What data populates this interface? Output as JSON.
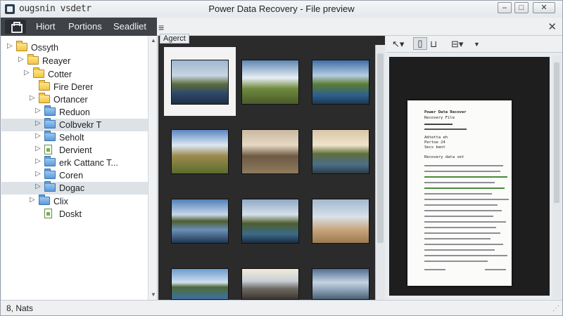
{
  "window": {
    "left_title": "ougsnin vsdetr",
    "title": "Power Data Recovery - File preview",
    "minimize_label": "–",
    "maximize_label": "□",
    "close_label": "✕"
  },
  "menu": {
    "items": [
      "Hiort",
      "Portions",
      "Seadliet"
    ],
    "hamburger": "≡",
    "close": "✕"
  },
  "tree": {
    "items": [
      {
        "label": "Ossyth",
        "icon": "folder-icon",
        "color": "yellow"
      },
      {
        "label": "Reayer",
        "icon": "folder-icon",
        "color": "yellow"
      },
      {
        "label": "Cotter",
        "icon": "folder-icon",
        "color": "yellow"
      },
      {
        "label": "Fire Derer",
        "icon": "folder-icon",
        "color": "yellow"
      },
      {
        "label": "Ortancer",
        "icon": "folder-icon",
        "color": "yellow"
      },
      {
        "label": "Reduon",
        "icon": "folder-icon",
        "color": "blue"
      },
      {
        "label": "Colbvekr T",
        "icon": "folder-icon",
        "color": "blue"
      },
      {
        "label": "Seholt",
        "icon": "folder-icon",
        "color": "blue"
      },
      {
        "label": "Dervient",
        "icon": "file-icon",
        "color": "green"
      },
      {
        "label": "erk Cattanc T...",
        "icon": "folder-icon",
        "color": "blue"
      },
      {
        "label": "Coren",
        "icon": "folder-icon",
        "color": "blue"
      },
      {
        "label": "Dogac",
        "icon": "folder-icon",
        "color": "blue"
      },
      {
        "label": "Clix",
        "icon": "folder-icon",
        "color": "blue"
      },
      {
        "label": "Doskt",
        "icon": "file-icon",
        "color": "green"
      }
    ]
  },
  "grid": {
    "tab_label": "Agerct",
    "thumbnails": [
      "mountain-lake",
      "sky-road",
      "lake-mountains",
      "valley-road",
      "rock-mountain",
      "river-valley",
      "lake-reflection",
      "mountain-lake-2",
      "person-beach",
      "blue-lake",
      "pier-sunset",
      "sky-lake"
    ]
  },
  "preview": {
    "toolbar": [
      "pointer-icon",
      "page-icon",
      "cart-icon",
      "bookmark-icon"
    ],
    "doc_heading": "Power Data Recover",
    "doc_sub": "Recovery File",
    "doc_lines": [
      "Adtetta eh",
      "Pertoe 24",
      "Secs bent"
    ],
    "doc_section": "Recovery data set"
  },
  "status": {
    "text": "8, Nats"
  },
  "colors": {
    "accent": "#3f4348",
    "grid_bg": "#2b2b2b",
    "folder_yellow": "#f4c543",
    "folder_blue": "#5d9bd9"
  }
}
